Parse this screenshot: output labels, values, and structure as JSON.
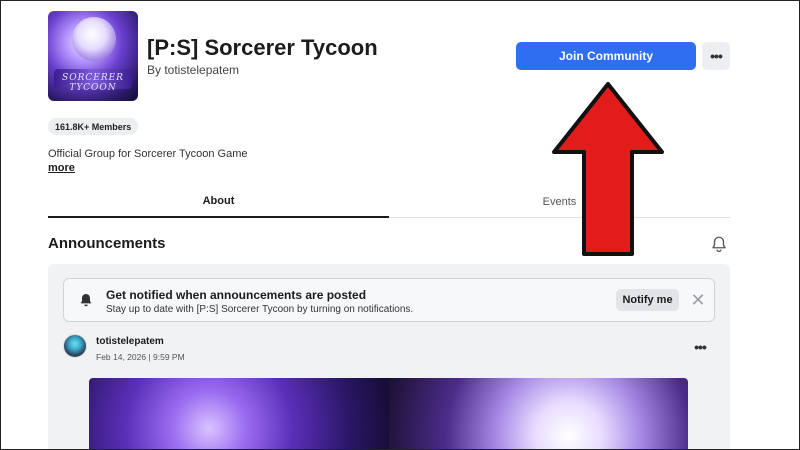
{
  "group": {
    "name": "[P:S] Sorcerer Tycoon",
    "byline": "By totistelepatem",
    "thumbnail_logo_text": "SORCERER TYCOON",
    "members": "161.8K+ Members",
    "description": "Official Group for Sorcerer Tycoon Game",
    "more_label": "more"
  },
  "actions": {
    "join_label": "Join Community",
    "more_icon": "ellipsis-icon"
  },
  "tabs": [
    {
      "label": "About",
      "active": true
    },
    {
      "label": "Events",
      "active": false
    }
  ],
  "announcements": {
    "title": "Announcements",
    "notify_card": {
      "title": "Get notified when announcements are posted",
      "subtitle": "Stay up to date with [P:S] Sorcerer Tycoon by turning on notifications.",
      "button_label": "Notify me",
      "close_symbol": "✕"
    },
    "post": {
      "author": "totistelepatem",
      "date": "Feb 14, 2026 | 9:59 PM"
    }
  },
  "colors": {
    "accent": "#2f6ef0",
    "arrow": "#e31b1b"
  }
}
